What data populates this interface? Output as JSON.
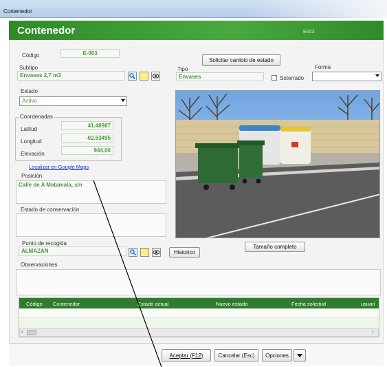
{
  "window": {
    "title": "Contenedor"
  },
  "header": {
    "title": "Contenedor",
    "code": "E003"
  },
  "form": {
    "codigo_label": "Código",
    "codigo_value": "E-003",
    "subtipo_label": "Subtipo",
    "subtipo_value": "Envases 2,7 m3",
    "estado_label": "Estado",
    "estado_value": "Activo",
    "solicitar_button": "Solicitar cambio de estado",
    "tipo_label": "Tipo",
    "tipo_value": "Envases",
    "soterrado_label": "Soterrado",
    "forma_label": "Forma",
    "forma_value": ""
  },
  "coordenadas": {
    "group_label": "Coordenadas",
    "latitud_label": "Latitud",
    "latitud_value": "41.48987",
    "longitud_label": "Longitud",
    "longitud_value": "-02.53495",
    "elevacion_label": "Elevación",
    "elevacion_value": "944,00"
  },
  "localizar_link": "Localizar en Google Maps",
  "posicion": {
    "label": "Posición",
    "value": "Calle de A Matamala, s/n"
  },
  "estado_conservacion": {
    "label": "Estado de conservación",
    "value": ""
  },
  "punto_recogida": {
    "label": "Punto de recogida",
    "value": "ALMAZAN",
    "historico_button": "Historico"
  },
  "tamano_button": "Tamaño completo",
  "observaciones": {
    "label": "Observaciones",
    "value": ""
  },
  "grid": {
    "columns": [
      "Código",
      "Contenedor",
      "Estado actual",
      "Nuevo estado",
      "Fecha solicitud",
      "usuari"
    ]
  },
  "footer": {
    "aceptar": "Aceptar (F12)",
    "cancelar": "Cancelar (Esc)",
    "opciones": "Opciones"
  },
  "icons": [
    "search-icon",
    "note-icon",
    "eye-icon",
    "chevron-down-icon",
    "scroll-left-icon",
    "scroll-right-icon"
  ],
  "colors": {
    "accent_green": "#2f8a2a",
    "value_green": "#4a9b3e",
    "link_blue": "#1a33c8"
  }
}
